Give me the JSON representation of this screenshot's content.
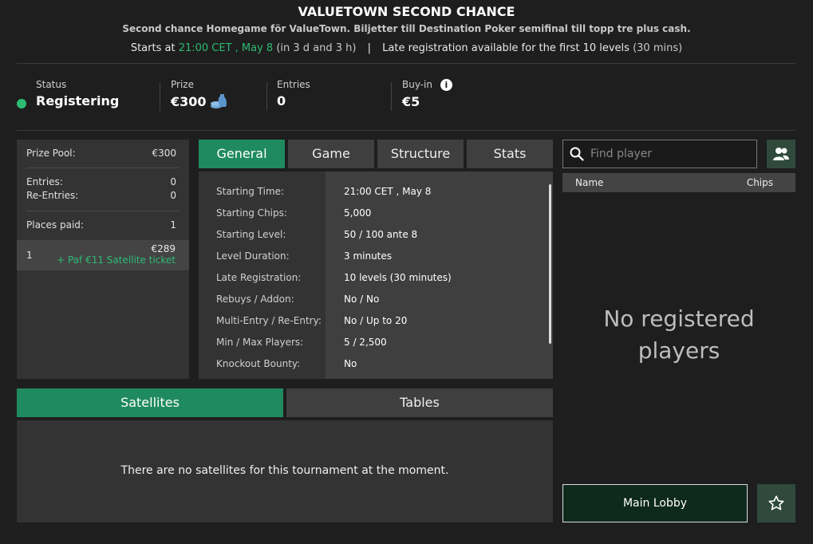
{
  "header": {
    "title": "VALUETOWN SECOND CHANCE",
    "subtitle": "Second chance Homegame för ValueTown. Biljetter till Destination Poker semifinal till topp tre plus cash.",
    "starts_label": "Starts at",
    "start_time": "21:00 CET , May 8",
    "countdown": "(in 3 d and 3 h)",
    "separator": "|",
    "late_reg": "Late registration available for the first 10 levels",
    "late_reg_duration": "(30 mins)"
  },
  "stats": {
    "status": {
      "label": "Status",
      "value": "Registering"
    },
    "prize": {
      "label": "Prize",
      "value": "€300"
    },
    "entries": {
      "label": "Entries",
      "value": "0"
    },
    "buyin": {
      "label": "Buy-in",
      "value": "€5",
      "info_icon": "i"
    }
  },
  "prize_panel": {
    "prize_pool": {
      "label": "Prize Pool:",
      "value": "€300"
    },
    "entries": {
      "label": "Entries:",
      "value": "0"
    },
    "reentries": {
      "label": "Re-Entries:",
      "value": "0"
    },
    "places_paid": {
      "label": "Places paid:",
      "value": "1"
    },
    "payout": {
      "place": "1",
      "amount": "€289",
      "extra": "+ Paf €11 Satellite ticket"
    }
  },
  "tabs": [
    "General",
    "Game",
    "Structure",
    "Stats"
  ],
  "details": [
    {
      "label": "Starting Time:",
      "value": "21:00 CET , May 8"
    },
    {
      "label": "Starting Chips:",
      "value": "5,000"
    },
    {
      "label": "Starting Level:",
      "value": "50 / 100 ante 8"
    },
    {
      "label": "Level Duration:",
      "value": "3 minutes"
    },
    {
      "label": "Late Registration:",
      "value": "10 levels (30 minutes)"
    },
    {
      "label": "Rebuys / Addon:",
      "value": "No / No"
    },
    {
      "label": "Multi-Entry / Re-Entry:",
      "value": "No / Up to 20"
    },
    {
      "label": "Min / Max Players:",
      "value": "5 / 2,500"
    },
    {
      "label": "Knockout Bounty:",
      "value": "No"
    }
  ],
  "bottom_tabs": [
    "Satellites",
    "Tables"
  ],
  "satellites_message": "There are no satellites for this tournament at the moment.",
  "players": {
    "search_placeholder": "Find player",
    "col_name": "Name",
    "col_chips": "Chips",
    "empty_message": "No registered players"
  },
  "buttons": {
    "main_lobby": "Main Lobby"
  },
  "colors": {
    "accent": "#1f8a5e",
    "status_green": "#2dbb73",
    "background": "#1e1e1e"
  }
}
